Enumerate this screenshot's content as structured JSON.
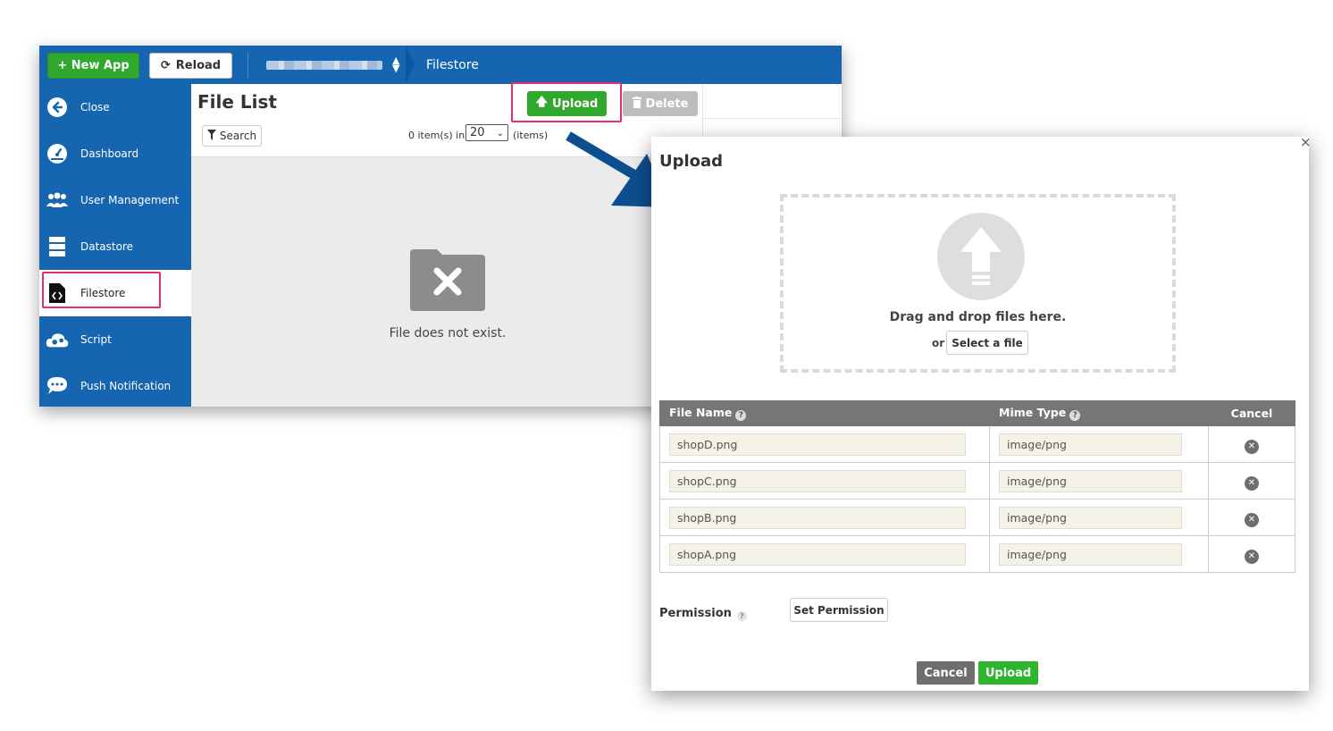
{
  "topbar": {
    "new_app_label": "+ New App",
    "reload_label": "Reload",
    "breadcrumb": "Filestore"
  },
  "sidebar": {
    "items": [
      {
        "label": "Close",
        "icon": "arrow-left-circle-icon"
      },
      {
        "label": "Dashboard",
        "icon": "speedometer-icon"
      },
      {
        "label": "User Management",
        "icon": "users-icon"
      },
      {
        "label": "Datastore",
        "icon": "database-icon"
      },
      {
        "label": "Filestore",
        "icon": "file-code-icon"
      },
      {
        "label": "Script",
        "icon": "cloud-gear-icon"
      },
      {
        "label": "Push Notification",
        "icon": "chat-bubble-icon"
      }
    ],
    "active": "Filestore"
  },
  "file_list": {
    "title": "File List",
    "search_label": "Search",
    "count_prefix": "0 item(s) in",
    "page_size": "20",
    "count_suffix": "(items)",
    "upload_label": "Upload",
    "delete_label": "Delete",
    "empty_message": "File does not exist."
  },
  "dialog": {
    "title": "Upload",
    "close_glyph": "×",
    "drop_text": "Drag and drop files here.",
    "or_text": "or",
    "select_file_label": "Select a file",
    "columns": {
      "file_name": "File Name",
      "mime_type": "Mime Type",
      "cancel": "Cancel"
    },
    "files": [
      {
        "name": "shopD.png",
        "mime": "image/png"
      },
      {
        "name": "shopC.png",
        "mime": "image/png"
      },
      {
        "name": "shopB.png",
        "mime": "image/png"
      },
      {
        "name": "shopA.png",
        "mime": "image/png"
      }
    ],
    "permission_label": "Permission",
    "set_permission_label": "Set Permission",
    "cancel_label": "Cancel",
    "upload_label": "Upload"
  },
  "colors": {
    "brand_blue": "#1565b0",
    "green": "#2fa82d",
    "highlight_pink": "#e0306e",
    "arrow_blue": "#0d4f8e"
  }
}
